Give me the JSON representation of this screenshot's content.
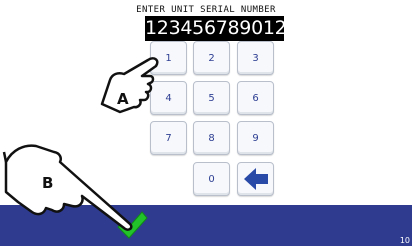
{
  "header": {
    "title": "ENTER UNIT SERIAL NUMBER",
    "serial_value": "1234567890123"
  },
  "keypad": {
    "keys": [
      "1",
      "2",
      "3",
      "4",
      "5",
      "6",
      "7",
      "8",
      "9",
      "0"
    ],
    "backspace_icon": "left-arrow-icon"
  },
  "footer": {
    "confirm_icon": "check-icon",
    "version": "10"
  },
  "annotations": {
    "hand_a_label": "A",
    "hand_b_label": "B"
  },
  "colors": {
    "bar": "#2e3b8f",
    "key_text": "#2e3f93",
    "check": "#22c22a",
    "arrow": "#2a4aa8"
  }
}
